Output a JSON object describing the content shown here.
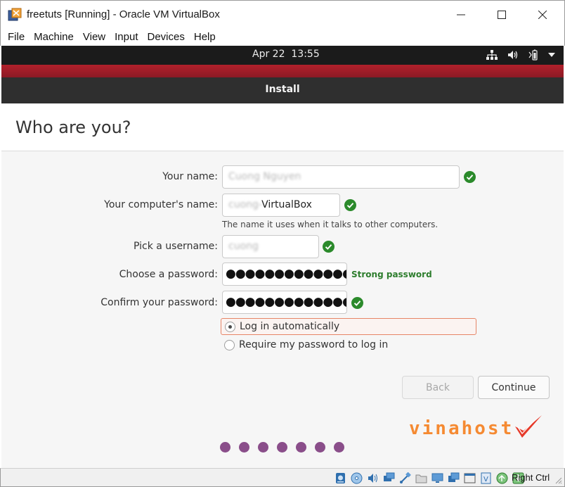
{
  "window": {
    "title": "freetuts [Running] - Oracle VM VirtualBox",
    "icon": "virtualbox-logo-icon"
  },
  "menu": [
    "File",
    "Machine",
    "View",
    "Input",
    "Devices",
    "Help"
  ],
  "ubuntu_bar": {
    "clock": "Apr 22  13:55",
    "tray_icons": [
      "network-icon",
      "volume-icon",
      "battery-icon",
      "dropdown-arrow-icon"
    ]
  },
  "installer": {
    "header": "Install",
    "page_title": "Who are you?"
  },
  "form": {
    "name_label": "Your name:",
    "name_value": "Cuong Nguyen",
    "computer_label": "Your computer's name:",
    "computer_value_blurred": "cuong-",
    "computer_value_suffix": "VirtualBox",
    "computer_hint": "The name it uses when it talks to other computers.",
    "username_label": "Pick a username:",
    "username_value": "cuong",
    "password_label": "Choose a password:",
    "password_value": "●●●●●●●●●●●●●●",
    "password_strength": "Strong password",
    "confirm_label": "Confirm your password:",
    "confirm_value": "●●●●●●●●●●●●●●",
    "radio_auto": "Log in automatically",
    "radio_require": "Require my password to log in",
    "selected": "auto"
  },
  "buttons": {
    "back": "Back",
    "continue": "Continue"
  },
  "progress": {
    "total_dots": 7
  },
  "watermark": "vinahost",
  "statusbar": {
    "icons": [
      "hard-disk-icon",
      "optical-drive-icon",
      "audio-icon",
      "network-adapter-icon",
      "usb-icon",
      "shared-folders-icon",
      "display-icon",
      "recording-icon",
      "vm-window-icon",
      "capture-icon",
      "mouse-integration-icon",
      "arrow-down-icon"
    ],
    "host_key": "Right Ctrl"
  },
  "colors": {
    "ubuntu_red": "#b1202b",
    "check_green": "#2b8a2b",
    "progress_purple": "#8a4e8a",
    "focus_orange": "#e68567",
    "watermark_orange": "#f58a32"
  }
}
